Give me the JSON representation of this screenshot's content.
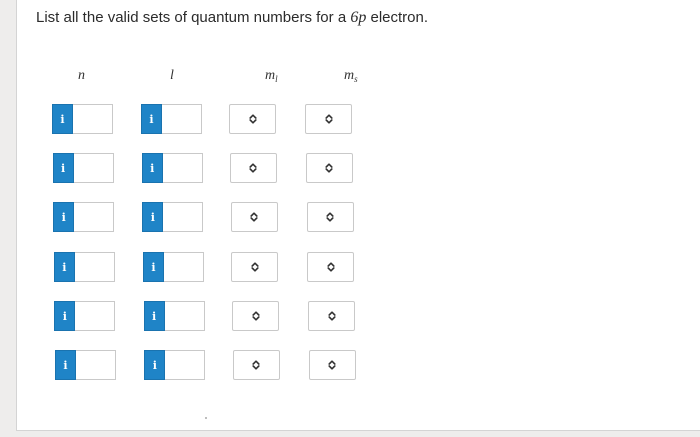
{
  "question": {
    "prefix": "List all the valid sets of quantum numbers for a ",
    "orbital": "6p",
    "suffix": " electron."
  },
  "columns": {
    "n": "n",
    "l": "l",
    "ml_base": "m",
    "ml_sub": "l",
    "ms_base": "m",
    "ms_sub": "s"
  },
  "info_badge_glyph": "i",
  "chevron_icon": "up-down-chevron-icon",
  "rows": [
    {
      "n": "",
      "l": "",
      "ml": "",
      "ms": ""
    },
    {
      "n": "",
      "l": "",
      "ml": "",
      "ms": ""
    },
    {
      "n": "",
      "l": "",
      "ml": "",
      "ms": ""
    },
    {
      "n": "",
      "l": "",
      "ml": "",
      "ms": ""
    },
    {
      "n": "",
      "l": "",
      "ml": "",
      "ms": ""
    },
    {
      "n": "",
      "l": "",
      "ml": "",
      "ms": ""
    }
  ],
  "colors": {
    "badge": "#1f84c7",
    "border": "#c9c9c9",
    "background": "#eeedec"
  }
}
